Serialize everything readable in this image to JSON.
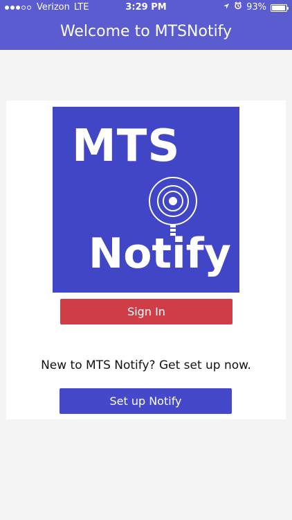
{
  "status_bar": {
    "carrier": "Verizon",
    "network": "LTE",
    "time": "3:29 PM",
    "battery_percent_label": "93%",
    "battery_level": 0.93,
    "signal_bars_filled": 3,
    "signal_bars_total": 5,
    "icons": [
      "location-arrow-icon",
      "alarm-clock-icon",
      "battery-icon"
    ]
  },
  "header": {
    "title": "Welcome to MTSNotify"
  },
  "logo": {
    "line1": "MTS",
    "line2": "Notify",
    "colors": {
      "background": "#4146c7",
      "foreground": "#ffffff"
    }
  },
  "actions": {
    "sign_in_label": "Sign In",
    "setup_prompt": "New to MTS Notify? Get set up now.",
    "setup_label": "Set up Notify"
  },
  "colors": {
    "header_bg": "#5a5cd0",
    "sign_in_bg": "#cf3e46",
    "setup_bg": "#4549c9",
    "page_bg": "#f4f4f4"
  }
}
